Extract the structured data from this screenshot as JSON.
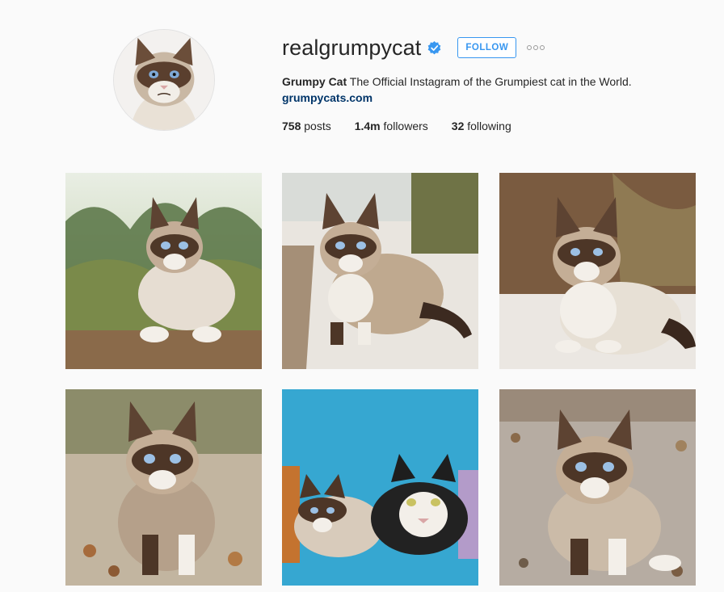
{
  "profile": {
    "username": "realgrumpycat",
    "verified": true,
    "follow_label": "FOLLOW",
    "more_label": "More options",
    "full_name": "Grumpy Cat",
    "bio": "The Official Instagram of the Grumpiest cat in the World.",
    "website": "grumpycats.com",
    "stats": {
      "posts_count": "758",
      "posts_label": "posts",
      "followers_count": "1.4m",
      "followers_label": "followers",
      "following_count": "32",
      "following_label": "following"
    }
  },
  "colors": {
    "accent": "#3897f0",
    "link": "#003569",
    "verified": "#3897f0",
    "background": "#fafafa"
  },
  "posts": [
    {
      "id": "post-1",
      "scene": "cat crouching in green grass"
    },
    {
      "id": "post-2",
      "scene": "cat walking on concrete path"
    },
    {
      "id": "post-3",
      "scene": "cat crouching on stone ledge"
    },
    {
      "id": "post-4",
      "scene": "cat on autumn leaves"
    },
    {
      "id": "post-5",
      "scene": "two cats on blue background"
    },
    {
      "id": "post-6",
      "scene": "cat on gravel ground"
    }
  ]
}
